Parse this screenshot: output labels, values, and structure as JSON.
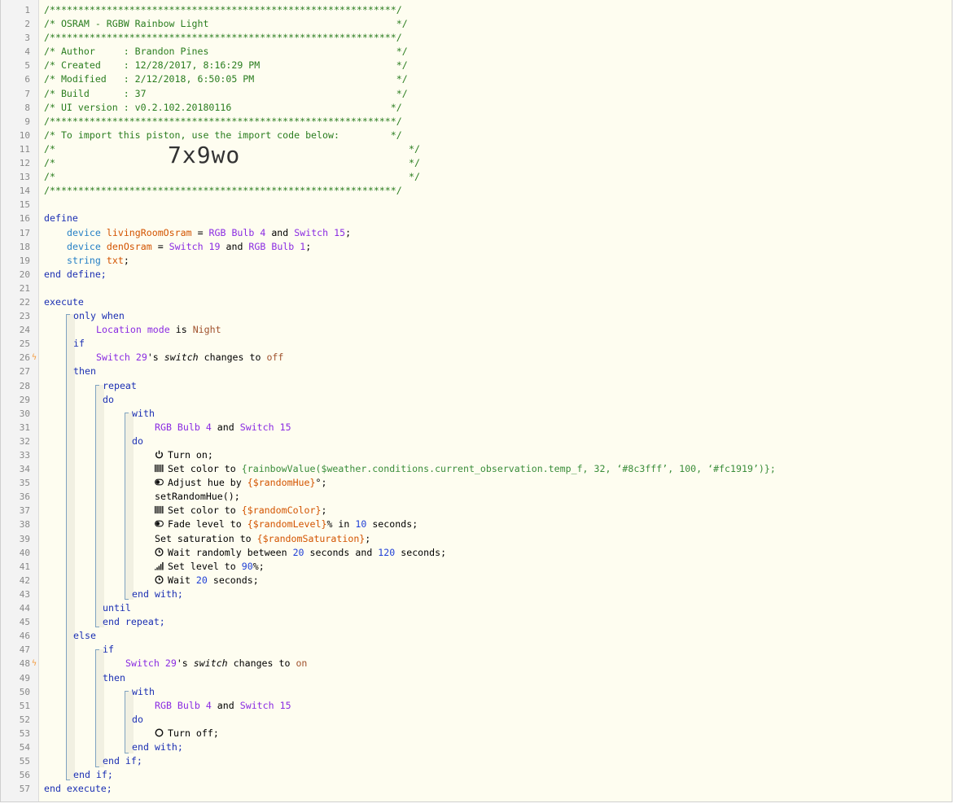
{
  "header": {
    "border": "/*************************************************************/",
    "title": "/* OSRAM - RGBW Rainbow Light                                 */",
    "author": "/* Author     : Brandon Pines                                 */",
    "created": "/* Created    : 12/28/2017, 8:16:29 PM                        */",
    "modified": "/* Modified   : 2/12/2018, 6:50:05 PM                         */",
    "build": "/* Build      : 37                                            */",
    "ui_version": "/* UI version : v0.2.102.20180116                            */",
    "import_note": "/* To import this piston, use the import code below:         */",
    "blank_start": "/*",
    "blank_end": "*/",
    "import_code": "7x9wo"
  },
  "code": {
    "define": "define",
    "device": "device",
    "string": "string",
    "living_room_var": "livingRoomOsram",
    "den_var": "denOsram",
    "txt_var": "txt",
    "rgb_bulb_4": "RGB Bulb 4",
    "switch_15": "Switch 15",
    "switch_19": "Switch 19",
    "rgb_bulb_1": "RGB Bulb 1",
    "end_define": "end define;",
    "execute": "execute",
    "only_when": "only when",
    "location_mode": "Location mode",
    "is": "is",
    "night": "Night",
    "if": "if",
    "switch_29": "Switch 29",
    "switch_attr": "switch",
    "changes_to": "changes to",
    "off": "off",
    "on": "on",
    "then": "then",
    "repeat": "repeat",
    "do": "do",
    "with": "with",
    "and": "and",
    "turn_on": "Turn on;",
    "set_color_to": "Set color to",
    "rainbow_expr": "{rainbowValue($weather.conditions.current_observation.temp_f, 32, ‘#8c3fff’, 100, ‘#fc1919’)};",
    "adjust_hue_by": "Adjust hue by",
    "random_hue": "{$randomHue}",
    "deg": "°;",
    "set_random_hue": "setRandomHue();",
    "random_color": "{$randomColor}",
    "fade_level_to": "Fade level to",
    "random_level": "{$randomLevel}",
    "pct_in": "% in",
    "ten": "10",
    "seconds": "seconds;",
    "seconds_and": "seconds and",
    "set_saturation_to": "Set saturation to",
    "random_saturation": "{$randomSaturation}",
    "wait_randomly_between": "Wait randomly between",
    "twenty": "20",
    "one_twenty": "120",
    "set_level_to": "Set level to",
    "ninety": "90",
    "pct": "%;",
    "wait": "Wait",
    "end_with": "end with;",
    "until": "until",
    "end_repeat": "end repeat;",
    "else": "else",
    "turn_off": "Turn off;",
    "end_if": "end if;",
    "end_execute": "end execute;",
    "semi": ";",
    "eq": "=",
    "poss": "'s",
    "semicolon": ";"
  },
  "line_numbers": [
    "1",
    "2",
    "3",
    "4",
    "5",
    "6",
    "7",
    "8",
    "9",
    "10",
    "11",
    "12",
    "13",
    "14",
    "15",
    "16",
    "17",
    "18",
    "19",
    "20",
    "21",
    "22",
    "23",
    "24",
    "25",
    "26",
    "27",
    "28",
    "29",
    "30",
    "31",
    "32",
    "33",
    "34",
    "35",
    "36",
    "37",
    "38",
    "39",
    "40",
    "41",
    "42",
    "43",
    "44",
    "45",
    "46",
    "47",
    "48",
    "49",
    "50",
    "51",
    "52",
    "53",
    "54",
    "55",
    "56",
    "57"
  ],
  "trigger_glyph": "ϟ",
  "icons": {
    "power": "power-icon",
    "color": "color-bars-icon",
    "toggle": "toggle-icon",
    "clock": "clock-icon",
    "signal": "signal-bars-icon",
    "circle": "circle-off-icon",
    "trigger": "lightning-icon"
  },
  "colors": {
    "comment": "#2a7d1f",
    "keyword": "#1b2fb3",
    "device": "#8a2be2",
    "variable": "#d35400",
    "background": "#fefdf0"
  }
}
